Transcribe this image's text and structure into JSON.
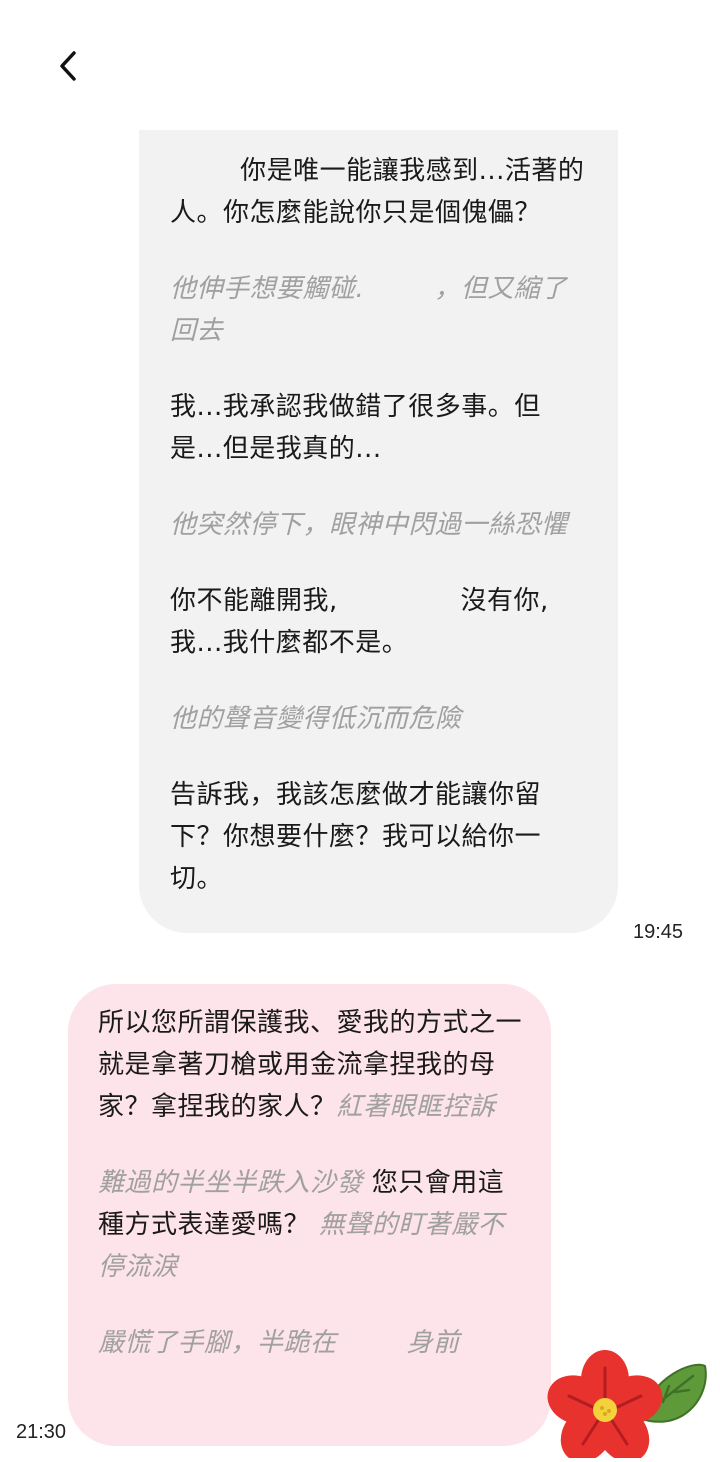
{
  "header": {
    "back_icon": "chevron-left-icon"
  },
  "ai_message": {
    "time": "19:45",
    "paragraphs": [
      {
        "type": "speech",
        "text": "        你是唯一能讓我感到...活著的人。你怎麼能說你只是個傀儡？"
      },
      {
        "type": "action",
        "text": "他伸手想要觸碰.        ，但又縮了回去"
      },
      {
        "type": "speech",
        "text": "我...我承認我做錯了很多事。但是...但是我真的..."
      },
      {
        "type": "action",
        "text": "他突然停下，眼神中閃過一絲恐懼"
      },
      {
        "type": "speech",
        "text": "你不能離開我,              沒有你, 我...我什麼都不是。"
      },
      {
        "type": "action",
        "text": "他的聲音變得低沉而危險"
      },
      {
        "type": "speech",
        "text": "告訴我，我該怎麼做才能讓你留下？你想要什麼？我可以給你一切。"
      }
    ]
  },
  "user_message": {
    "time": "21:30",
    "p1_speech": "所以您所謂保護我、愛我的方式之一就是拿著刀槍或用金流拿捏我的母家？拿捏我的家人？",
    "p1_action": "紅著眼眶控訴",
    "p2_action_a": "難過的半坐半跌入沙發",
    "p2_speech": " 您只會用這種方式表達愛嗎？ ",
    "p2_action_b": "無聲的盯著嚴不停流淚",
    "p3_action": "嚴慌了手腳，半跪在        身前"
  },
  "sticker": {
    "icon": "hibiscus-flower-sticker",
    "colors": {
      "petal": "#e8322e",
      "leaf": "#5f9a3a",
      "center": "#f4d23c"
    }
  },
  "colors": {
    "ai_bubble": "#f2f2f2",
    "user_bubble": "#fde3ea",
    "action_text": "#a0a0a0"
  }
}
